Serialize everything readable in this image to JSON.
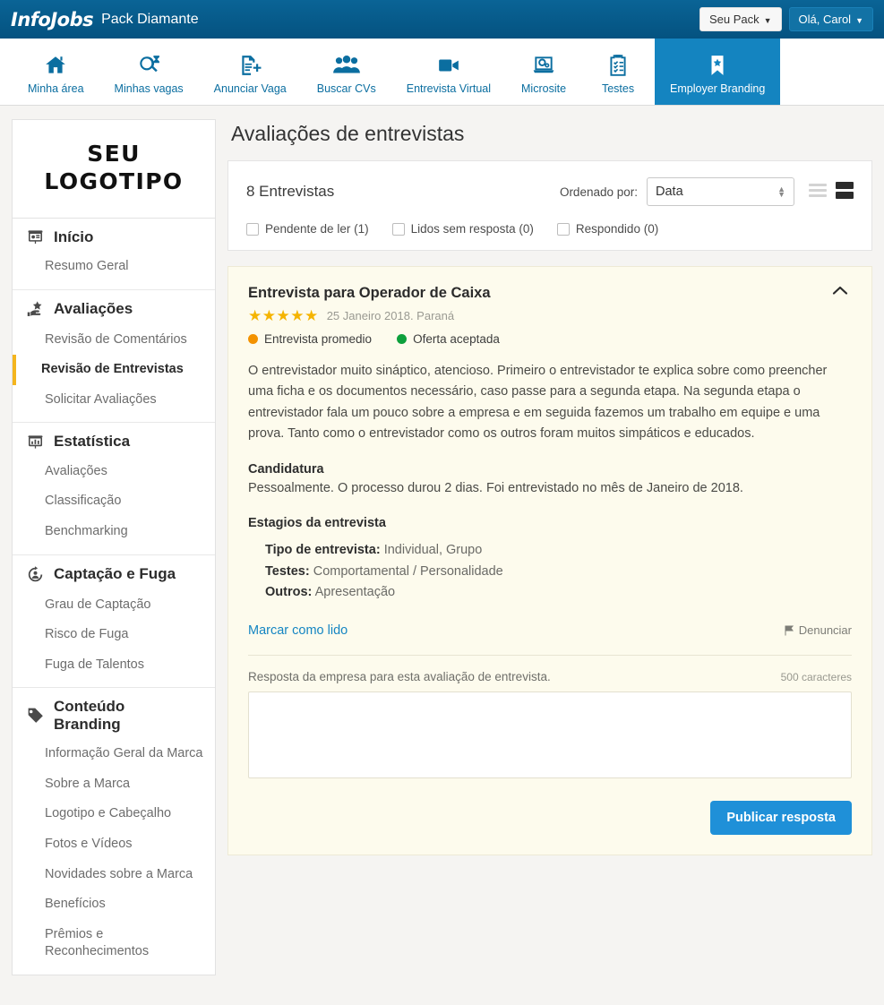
{
  "topbar": {
    "logo": "InfoJobs",
    "pack_title": "Pack Diamante",
    "pack_button": "Seu Pack",
    "user_button": "Olá, Carol"
  },
  "mainnav": {
    "items": [
      {
        "label": "Minha área",
        "icon": "home-icon",
        "active": false
      },
      {
        "label": "Minhas vagas",
        "icon": "search-jobs-icon",
        "active": false
      },
      {
        "label": "Anunciar Vaga",
        "icon": "document-plus-icon",
        "active": false
      },
      {
        "label": "Buscar CVs",
        "icon": "people-icon",
        "active": false
      },
      {
        "label": "Entrevista Virtual",
        "icon": "video-camera-icon",
        "active": false
      },
      {
        "label": "Microsite",
        "icon": "laptop-gear-icon",
        "active": false
      },
      {
        "label": "Testes",
        "icon": "clipboard-check-icon",
        "active": false
      },
      {
        "label": "Employer Branding",
        "icon": "bookmark-star-icon",
        "active": true
      }
    ]
  },
  "sidebar": {
    "logo_line1": "SEU",
    "logo_line2": "LOGOTIPO",
    "groups": [
      {
        "label": "Início",
        "icon": "presentation-icon",
        "items": [
          {
            "label": "Resumo Geral",
            "selected": false
          }
        ]
      },
      {
        "label": "Avaliações",
        "icon": "hand-star-icon",
        "items": [
          {
            "label": "Revisão de Comentários",
            "selected": false
          },
          {
            "label": "Revisão de Entrevistas",
            "selected": true
          },
          {
            "label": "Solicitar Avaliações",
            "selected": false
          }
        ]
      },
      {
        "label": "Estatística",
        "icon": "chart-board-icon",
        "items": [
          {
            "label": "Avaliações",
            "selected": false
          },
          {
            "label": "Classificação",
            "selected": false
          },
          {
            "label": "Benchmarking",
            "selected": false
          }
        ]
      },
      {
        "label": "Captação e Fuga",
        "icon": "user-refresh-icon",
        "items": [
          {
            "label": "Grau de Captação",
            "selected": false
          },
          {
            "label": "Risco de Fuga",
            "selected": false
          },
          {
            "label": "Fuga de Talentos",
            "selected": false
          }
        ]
      },
      {
        "label": "Conteúdo Branding",
        "icon": "tag-icon",
        "items": [
          {
            "label": "Informação Geral da Marca",
            "selected": false
          },
          {
            "label": "Sobre a Marca",
            "selected": false
          },
          {
            "label": "Logotipo e Cabeçalho",
            "selected": false
          },
          {
            "label": "Fotos e Vídeos",
            "selected": false
          },
          {
            "label": "Novidades sobre a Marca",
            "selected": false
          },
          {
            "label": "Benefícios",
            "selected": false
          },
          {
            "label": "Prêmios e Reconhecimentos",
            "selected": false
          }
        ]
      }
    ]
  },
  "page": {
    "title": "Avaliações de entrevistas"
  },
  "toolbar": {
    "count_label": "8 Entrevistas",
    "sort_label": "Ordenado por:",
    "sort_value": "Data",
    "sort_options": [
      "Data"
    ],
    "filters": [
      {
        "label": "Pendente de ler (1)",
        "checked": false
      },
      {
        "label": "Lidos sem resposta (0)",
        "checked": false
      },
      {
        "label": "Respondido (0)",
        "checked": false
      }
    ]
  },
  "review": {
    "title": "Entrevista para Operador de Caixa",
    "rating": 5,
    "stars_glyphs": "★★★★★",
    "date_location": "25 Janeiro 2018. Paraná",
    "tags": [
      {
        "label": "Entrevista promedio",
        "color": "#f39200"
      },
      {
        "label": "Oferta aceptada",
        "color": "#0da03c"
      }
    ],
    "body": "O entrevistador muito sináptico, atencioso. Primeiro o entrevistador te explica sobre como preencher uma ficha e os documentos necessário, caso passe para a segunda etapa. Na segunda etapa o entrevistador fala um pouco sobre a empresa e em seguida fazemos um trabalho em equipe e uma prova. Tanto como o entrevistador como os outros foram muitos simpáticos e educados.",
    "candidatura_heading": "Candidatura",
    "candidatura_text": "Pessoalmente. O processo durou 2 dias. Foi entrevistado no mês de Janeiro de 2018.",
    "stages_heading": "Estagios da entrevista",
    "stages": [
      {
        "key": "Tipo de entrevista:",
        "value": "Individual, Grupo"
      },
      {
        "key": "Testes:",
        "value": "Comportamental / Personalidade"
      },
      {
        "key": "Outros:",
        "value": "Apresentação"
      }
    ],
    "mark_read_link": "Marcar como lido",
    "report_link": "Denunciar",
    "collapse_icon": "chevron-up-icon"
  },
  "reply": {
    "label": "Resposta da empresa para esta avaliação de entrevista.",
    "char_limit": "500 caracteres",
    "textarea_value": "",
    "textarea_placeholder": "",
    "publish_button": "Publicar resposta"
  },
  "colors": {
    "brand_blue": "#055a8a",
    "nav_active": "#1484c0",
    "accent_yellow": "#f4b51e",
    "star_yellow": "#f5b400",
    "link_blue": "#1485c2",
    "publish_blue": "#1f90d8",
    "card_bg": "#fdfbed",
    "page_bg": "#f5f4f2"
  }
}
